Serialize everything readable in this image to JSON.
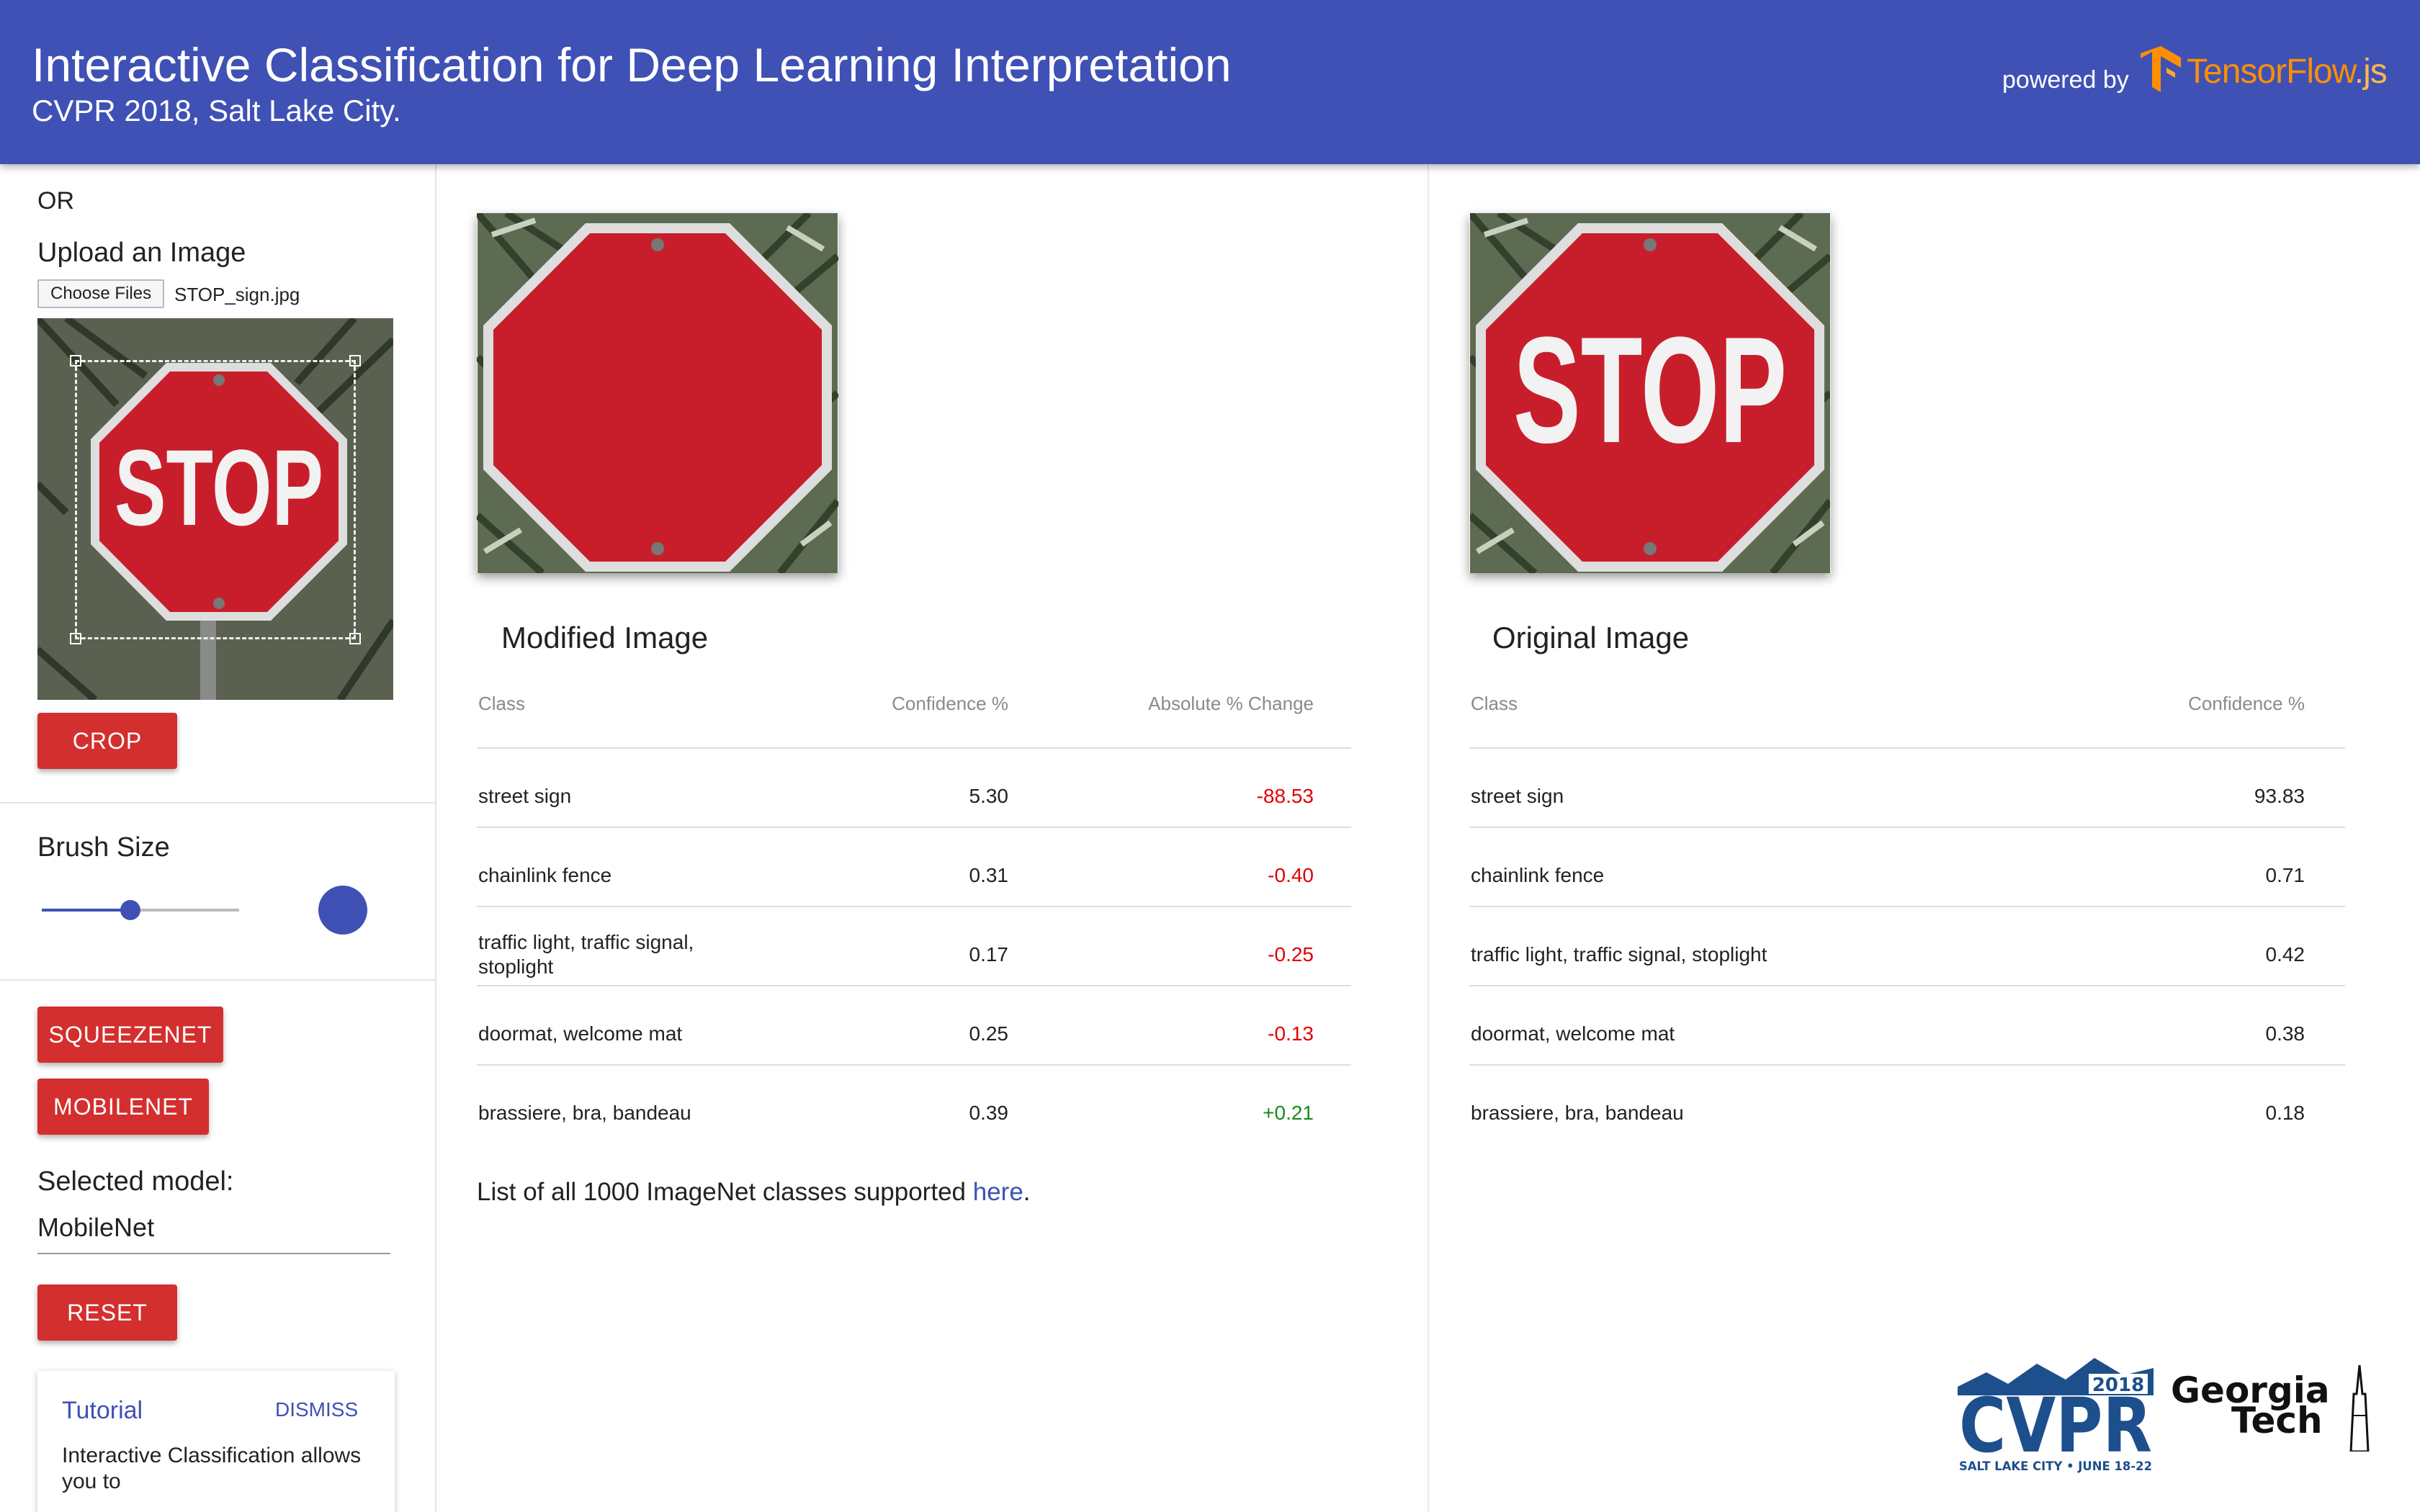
{
  "header": {
    "title": "Interactive Classification for Deep Learning Interpretation",
    "subtitle": "CVPR 2018, Salt Lake City.",
    "powered_by": "powered by",
    "tf_name": "TensorFlow",
    "tf_suffix": ".js"
  },
  "sidebar": {
    "or_text": "OR",
    "upload_label": "Upload an Image",
    "file_button": "Choose Files",
    "file_name": "STOP_sign.jpg",
    "crop_button": "CROP",
    "brush_label": "Brush Size",
    "brush_level": 0.45,
    "squeezenet_button": "SQUEEZENET",
    "mobilenet_button": "MOBILENET",
    "selected_model_label": "Selected model:",
    "selected_model_value": "MobileNet",
    "reset_button": "RESET",
    "tutorial": {
      "title": "Tutorial",
      "dismiss": "DISMISS",
      "text": "Interactive Classification allows you to"
    }
  },
  "stop_sign_text": "STOP",
  "modified": {
    "title": "Modified Image",
    "headers": {
      "class": "Class",
      "confidence": "Confidence %",
      "change": "Absolute % Change"
    },
    "rows": [
      {
        "class": "street sign",
        "confidence": "5.30",
        "change": "-88.53"
      },
      {
        "class": "chainlink fence",
        "confidence": "0.31",
        "change": "-0.40"
      },
      {
        "class": "traffic light, traffic signal, stoplight",
        "confidence": "0.17",
        "change": "-0.25"
      },
      {
        "class": "doormat, welcome mat",
        "confidence": "0.25",
        "change": "-0.13"
      },
      {
        "class": "brassiere, bra, bandeau",
        "confidence": "0.39",
        "change": "+0.21"
      }
    ]
  },
  "original": {
    "title": "Original Image",
    "headers": {
      "class": "Class",
      "confidence": "Confidence %"
    },
    "rows": [
      {
        "class": "street sign",
        "confidence": "93.83"
      },
      {
        "class": "chainlink fence",
        "confidence": "0.71"
      },
      {
        "class": "traffic light, traffic signal, stoplight",
        "confidence": "0.42"
      },
      {
        "class": "doormat, welcome mat",
        "confidence": "0.38"
      },
      {
        "class": "brassiere, bra, bandeau",
        "confidence": "0.18"
      }
    ]
  },
  "footer_note": {
    "text": "List of all 1000 ImageNet classes supported ",
    "link": "here",
    "end": "."
  },
  "logos": {
    "cvpr_year": "2018",
    "cvpr_name": "CVPR",
    "cvpr_tagline": "SALT LAKE CITY • JUNE 18-22",
    "gt_line1": "Georgia",
    "gt_line2": "Tech"
  },
  "colors": {
    "header": "#3f51b5",
    "accent_red": "#d32f2f",
    "negative": "#e00000",
    "positive": "#1a8a1a",
    "tensorflow_orange": "#ff8f00"
  }
}
